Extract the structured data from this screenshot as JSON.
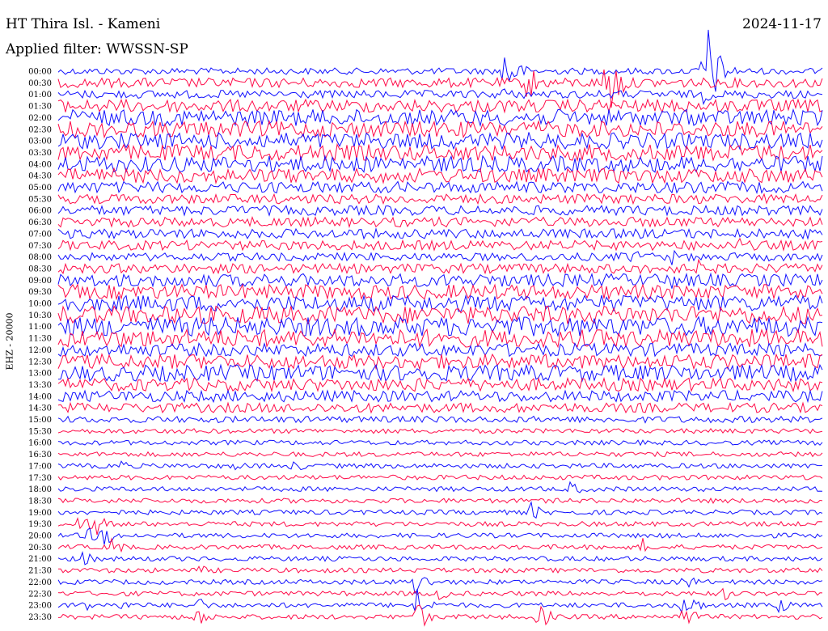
{
  "header": {
    "station": "HT Thira Isl. - Kameni",
    "date": "2024-11-17",
    "filter": "Applied filter: WWSSN-SP",
    "channel": "EHZ - 20000"
  },
  "colors": {
    "blue": "#1010ff",
    "red": "#ff0a48",
    "background": "#ffffff"
  },
  "chart_data": {
    "type": "line",
    "title": "HT Thira Isl. - Kameni",
    "subtitle": "Applied filter: WWSSN-SP",
    "ylabel": "EHZ - 20000",
    "x_unit": "minutes within trace row",
    "xlim": [
      0,
      30
    ],
    "row_colors": [
      "blue",
      "red"
    ],
    "rows": [
      {
        "label": "00:00",
        "amp": 4,
        "events": [
          {
            "t": 17.5,
            "a": 40
          },
          {
            "t": 25.3,
            "a": 90
          }
        ]
      },
      {
        "label": "00:30",
        "amp": 6,
        "events": [
          {
            "t": 18.4,
            "a": 30
          },
          {
            "t": 21.5,
            "a": 60
          }
        ]
      },
      {
        "label": "01:00",
        "amp": 5,
        "events": [
          {
            "t": 17.4,
            "a": 12
          },
          {
            "t": 25.3,
            "a": 12
          }
        ]
      },
      {
        "label": "01:30",
        "amp": 8,
        "events": [
          {
            "t": 17.5,
            "a": 8
          },
          {
            "t": 25.2,
            "a": 8
          }
        ]
      },
      {
        "label": "02:00",
        "amp": 10,
        "events": []
      },
      {
        "label": "02:30",
        "amp": 10,
        "events": [
          {
            "t": 3.4,
            "a": 10
          }
        ]
      },
      {
        "label": "03:00",
        "amp": 10,
        "events": [
          {
            "t": 18.4,
            "a": 12
          }
        ]
      },
      {
        "label": "03:30",
        "amp": 10,
        "events": [
          {
            "t": 18.4,
            "a": 10
          }
        ]
      },
      {
        "label": "04:00",
        "amp": 10,
        "events": [
          {
            "t": 18.4,
            "a": 14
          }
        ]
      },
      {
        "label": "04:30",
        "amp": 9,
        "events": [
          {
            "t": 18.4,
            "a": 10
          },
          {
            "t": 24.5,
            "a": 8
          }
        ]
      },
      {
        "label": "05:00",
        "amp": 7,
        "events": [
          {
            "t": 24.7,
            "a": 8
          }
        ]
      },
      {
        "label": "05:30",
        "amp": 6,
        "events": []
      },
      {
        "label": "06:00",
        "amp": 6,
        "events": []
      },
      {
        "label": "06:30",
        "amp": 6,
        "events": []
      },
      {
        "label": "07:00",
        "amp": 6,
        "events": [
          {
            "t": 22,
            "a": 8
          }
        ]
      },
      {
        "label": "07:30",
        "amp": 6,
        "events": [
          {
            "t": 26.7,
            "a": 10
          }
        ]
      },
      {
        "label": "08:00",
        "amp": 5,
        "events": [
          {
            "t": 22.5,
            "a": 14
          },
          {
            "t": 24,
            "a": 12
          }
        ]
      },
      {
        "label": "08:30",
        "amp": 6,
        "events": [
          {
            "t": 23.5,
            "a": 14
          },
          {
            "t": 25,
            "a": 14
          }
        ]
      },
      {
        "label": "09:00",
        "amp": 8,
        "events": [
          {
            "t": 24,
            "a": 16
          }
        ]
      },
      {
        "label": "09:30",
        "amp": 9,
        "events": [
          {
            "t": 25,
            "a": 14
          }
        ]
      },
      {
        "label": "10:00",
        "amp": 10,
        "events": []
      },
      {
        "label": "10:30",
        "amp": 11,
        "events": [
          {
            "t": 3.4,
            "a": 14
          }
        ]
      },
      {
        "label": "11:00",
        "amp": 12,
        "events": [
          {
            "t": 3.4,
            "a": 14
          },
          {
            "t": 14,
            "a": 12
          }
        ]
      },
      {
        "label": "11:30",
        "amp": 11,
        "events": [
          {
            "t": 3.4,
            "a": 12
          }
        ]
      },
      {
        "label": "12:00",
        "amp": 8,
        "events": [
          {
            "t": 14,
            "a": 14
          }
        ]
      },
      {
        "label": "12:30",
        "amp": 9,
        "events": [
          {
            "t": 14,
            "a": 16
          },
          {
            "t": 21,
            "a": 10
          }
        ]
      },
      {
        "label": "13:00",
        "amp": 10,
        "events": [
          {
            "t": 14,
            "a": 18
          },
          {
            "t": 25,
            "a": 12
          }
        ]
      },
      {
        "label": "13:30",
        "amp": 8,
        "events": [
          {
            "t": 14,
            "a": 12
          }
        ]
      },
      {
        "label": "14:00",
        "amp": 7,
        "events": []
      },
      {
        "label": "14:30",
        "amp": 6,
        "events": []
      },
      {
        "label": "15:00",
        "amp": 4,
        "events": [
          {
            "t": 14.6,
            "a": 8
          }
        ]
      },
      {
        "label": "15:30",
        "amp": 3,
        "events": []
      },
      {
        "label": "16:00",
        "amp": 3,
        "events": []
      },
      {
        "label": "16:30",
        "amp": 3,
        "events": []
      },
      {
        "label": "17:00",
        "amp": 3,
        "events": [
          {
            "t": 2.5,
            "a": 9
          },
          {
            "t": 7,
            "a": 8
          },
          {
            "t": 9.2,
            "a": 10
          },
          {
            "t": 22.5,
            "a": 6
          }
        ]
      },
      {
        "label": "17:30",
        "amp": 3,
        "events": []
      },
      {
        "label": "18:00",
        "amp": 3,
        "events": [
          {
            "t": 20.1,
            "a": 12
          }
        ]
      },
      {
        "label": "18:30",
        "amp": 3,
        "events": []
      },
      {
        "label": "19:00",
        "amp": 3,
        "events": [
          {
            "t": 18.5,
            "a": 14
          }
        ]
      },
      {
        "label": "19:30",
        "amp": 3,
        "events": [
          {
            "t": 0.8,
            "a": 16
          },
          {
            "t": 1.4,
            "a": 18
          }
        ]
      },
      {
        "label": "20:00",
        "amp": 3,
        "events": [
          {
            "t": 1,
            "a": 16
          },
          {
            "t": 1.8,
            "a": 16
          }
        ]
      },
      {
        "label": "20:30",
        "amp": 3,
        "events": [
          {
            "t": 2.1,
            "a": 14
          },
          {
            "t": 22.9,
            "a": 12
          }
        ]
      },
      {
        "label": "21:00",
        "amp": 3,
        "events": [
          {
            "t": 1,
            "a": 12
          }
        ]
      },
      {
        "label": "21:30",
        "amp": 3,
        "events": [
          {
            "t": 5.5,
            "a": 8
          }
        ]
      },
      {
        "label": "22:00",
        "amp": 3,
        "events": [
          {
            "t": 14,
            "a": 20
          },
          {
            "t": 24.5,
            "a": 14
          }
        ]
      },
      {
        "label": "22:30",
        "amp": 3,
        "events": [
          {
            "t": 14.9,
            "a": 10
          },
          {
            "t": 26.1,
            "a": 10
          }
        ]
      },
      {
        "label": "23:00",
        "amp": 3,
        "events": [
          {
            "t": 1,
            "a": 10
          },
          {
            "t": 2.3,
            "a": 10
          },
          {
            "t": 5.4,
            "a": 14
          },
          {
            "t": 14,
            "a": 26
          },
          {
            "t": 24.5,
            "a": 26
          },
          {
            "t": 28.3,
            "a": 12
          }
        ]
      },
      {
        "label": "23:30",
        "amp": 3,
        "events": [
          {
            "t": 5.4,
            "a": 16
          },
          {
            "t": 14,
            "a": 24
          },
          {
            "t": 18.8,
            "a": 20
          },
          {
            "t": 24.5,
            "a": 20
          }
        ]
      }
    ]
  }
}
